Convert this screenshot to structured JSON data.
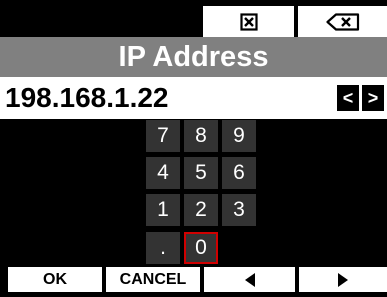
{
  "top_softkeys": {
    "clear_icon": "clear-x-icon",
    "backspace_icon": "backspace-icon"
  },
  "title": "IP Address",
  "field": {
    "value": "198.168.1.22",
    "cursor_left_label": "<",
    "cursor_right_label": ">"
  },
  "keypad": {
    "keys": [
      "7",
      "8",
      "9",
      "4",
      "5",
      "6",
      "1",
      "2",
      "3",
      ".",
      "0"
    ],
    "selected": "0"
  },
  "bottom_softkeys": {
    "ok_label": "OK",
    "cancel_label": "CANCEL",
    "prev_icon": "left-triangle-icon",
    "next_icon": "right-triangle-icon"
  },
  "colors": {
    "background": "#000000",
    "title_bar": "#808080",
    "key_fill": "#333333",
    "selected_border": "#d00000"
  }
}
